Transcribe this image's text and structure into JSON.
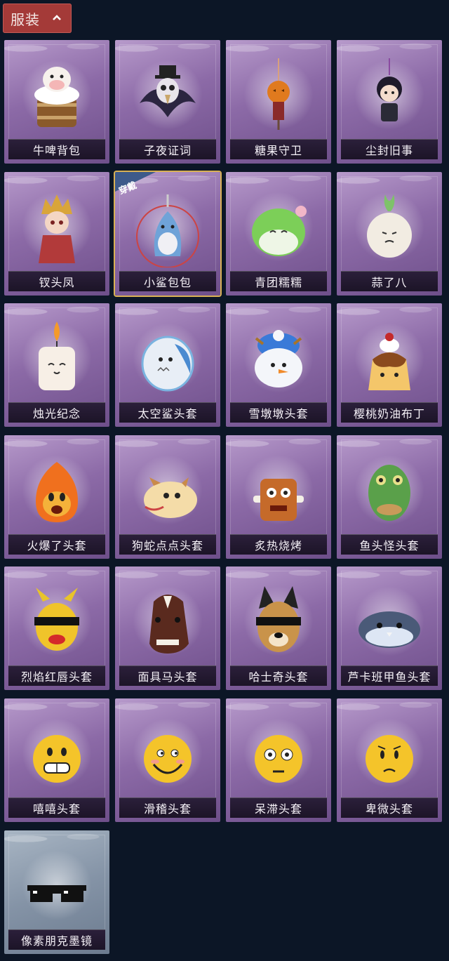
{
  "header": {
    "tab_label": "服装"
  },
  "equipped_badge": "穿戴",
  "items": [
    {
      "name": "牛啤背包",
      "icon": "cow-beer-backpack"
    },
    {
      "name": "子夜证词",
      "icon": "crow-mask"
    },
    {
      "name": "糖果守卫",
      "icon": "pumpkin-charm"
    },
    {
      "name": "尘封旧事",
      "icon": "doll-charm"
    },
    {
      "name": "钗头凤",
      "icon": "empress-doll"
    },
    {
      "name": "小鲨包包",
      "icon": "shark-bag"
    },
    {
      "name": "青团糯糯",
      "icon": "green-rice-ball"
    },
    {
      "name": "蒜了八",
      "icon": "garlic"
    },
    {
      "name": "烛光纪念",
      "icon": "candle"
    },
    {
      "name": "太空鲨头套",
      "icon": "space-shark"
    },
    {
      "name": "雪墩墩头套",
      "icon": "snowman"
    },
    {
      "name": "樱桃奶油布丁",
      "icon": "pudding"
    },
    {
      "name": "火爆了头套",
      "icon": "fireball"
    },
    {
      "name": "狗蛇点点头套",
      "icon": "dog-snake"
    },
    {
      "name": "炙热烧烤",
      "icon": "bbq"
    },
    {
      "name": "鱼头怪头套",
      "icon": "fish-head"
    },
    {
      "name": "烈焰红唇头套",
      "icon": "red-lips"
    },
    {
      "name": "面具马头套",
      "icon": "horse-mask"
    },
    {
      "name": "哈士奇头套",
      "icon": "husky"
    },
    {
      "name": "芦卡班甲鱼头套",
      "icon": "fish-blob"
    },
    {
      "name": "嘻嘻头套",
      "icon": "grin-emoji"
    },
    {
      "name": "滑稽头套",
      "icon": "funny-emoji"
    },
    {
      "name": "呆滞头套",
      "icon": "dazed-emoji"
    },
    {
      "name": "卑微头套",
      "icon": "humble-emoji"
    },
    {
      "name": "像素朋克墨镜",
      "icon": "pixel-sunglasses"
    }
  ],
  "equipped_index": 5
}
